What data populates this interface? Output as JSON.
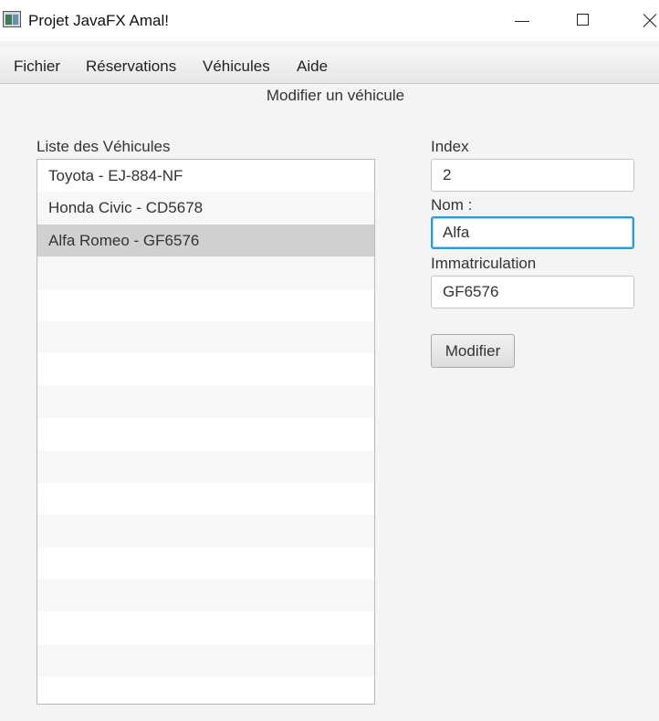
{
  "window": {
    "title": "Projet JavaFX Amal!"
  },
  "menu": {
    "items": [
      "Fichier",
      "Réservations",
      "Véhicules",
      "Aide"
    ]
  },
  "page": {
    "title": "Modifier un véhicule"
  },
  "list": {
    "label": "Liste des Véhicules",
    "items": [
      "Toyota - EJ-884-NF",
      "Honda Civic - CD5678",
      "Alfa Romeo - GF6576"
    ],
    "selected_index": 2
  },
  "form": {
    "index_label": "Index",
    "index_value": "2",
    "nom_label": "Nom :",
    "nom_value": "Alfa",
    "immat_label": "Immatriculation",
    "immat_value": "GF6576",
    "submit_label": "Modifier"
  },
  "colors": {
    "focus_border": "#2b9be0",
    "selection": "#d0d0d0"
  }
}
